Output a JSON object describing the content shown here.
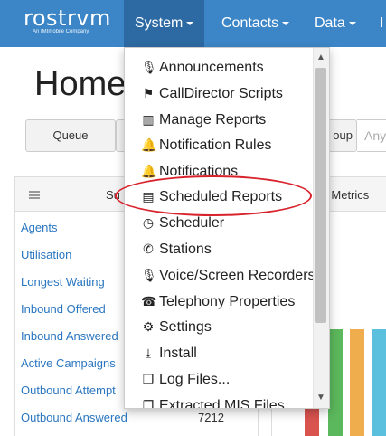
{
  "navbar": {
    "logo": "rostrvm",
    "logo_tagline": "An IMImobile Company",
    "items": [
      "System",
      "Contacts",
      "Data",
      "I"
    ]
  },
  "page": {
    "title": "Home",
    "tabs": [
      "Queue",
      "oup"
    ],
    "any_placeholder": "Any"
  },
  "summary_panel": {
    "title": "Su",
    "metrics": [
      {
        "label": "Agents",
        "value": ""
      },
      {
        "label": "Utilisation",
        "value": ""
      },
      {
        "label": "Longest Waiting",
        "value": ""
      },
      {
        "label": "Inbound Offered",
        "value": ""
      },
      {
        "label": "Inbound Answered",
        "value": ""
      },
      {
        "label": "Active Campaigns",
        "value": ""
      },
      {
        "label": "Outbound Attempt",
        "value": ""
      },
      {
        "label": "Outbound Answered",
        "value": "7212"
      }
    ]
  },
  "metrics_panel": {
    "title": "ll Metrics",
    "bar_colors": [
      "#d9534f",
      "#5cb85c",
      "#f0ad4e",
      "#5bc0de"
    ]
  },
  "system_menu": {
    "items": [
      {
        "label": "Announcements",
        "icon": "microphone-icon"
      },
      {
        "label": "CallDirector Scripts",
        "icon": "signpost-icon"
      },
      {
        "label": "Manage Reports",
        "icon": "bar-chart-icon"
      },
      {
        "label": "Notification Rules",
        "icon": "bell-icon"
      },
      {
        "label": "Notifications",
        "icon": "bell-icon"
      },
      {
        "label": "Scheduled Reports",
        "icon": "pdf-file-icon"
      },
      {
        "label": "Scheduler",
        "icon": "clock-icon"
      },
      {
        "label": "Stations",
        "icon": "phone-icon"
      },
      {
        "label": "Voice/Screen Recorders",
        "icon": "microphone-icon"
      },
      {
        "label": "Telephony Properties",
        "icon": "telephone-icon"
      },
      {
        "label": "Settings",
        "icon": "gear-icon"
      },
      {
        "label": "Install",
        "icon": "download-icon"
      },
      {
        "label": "Log Files...",
        "icon": "files-icon"
      },
      {
        "label": "Extracted MIS Files",
        "icon": "files-icon"
      }
    ],
    "highlight_color": "#d9232c"
  }
}
